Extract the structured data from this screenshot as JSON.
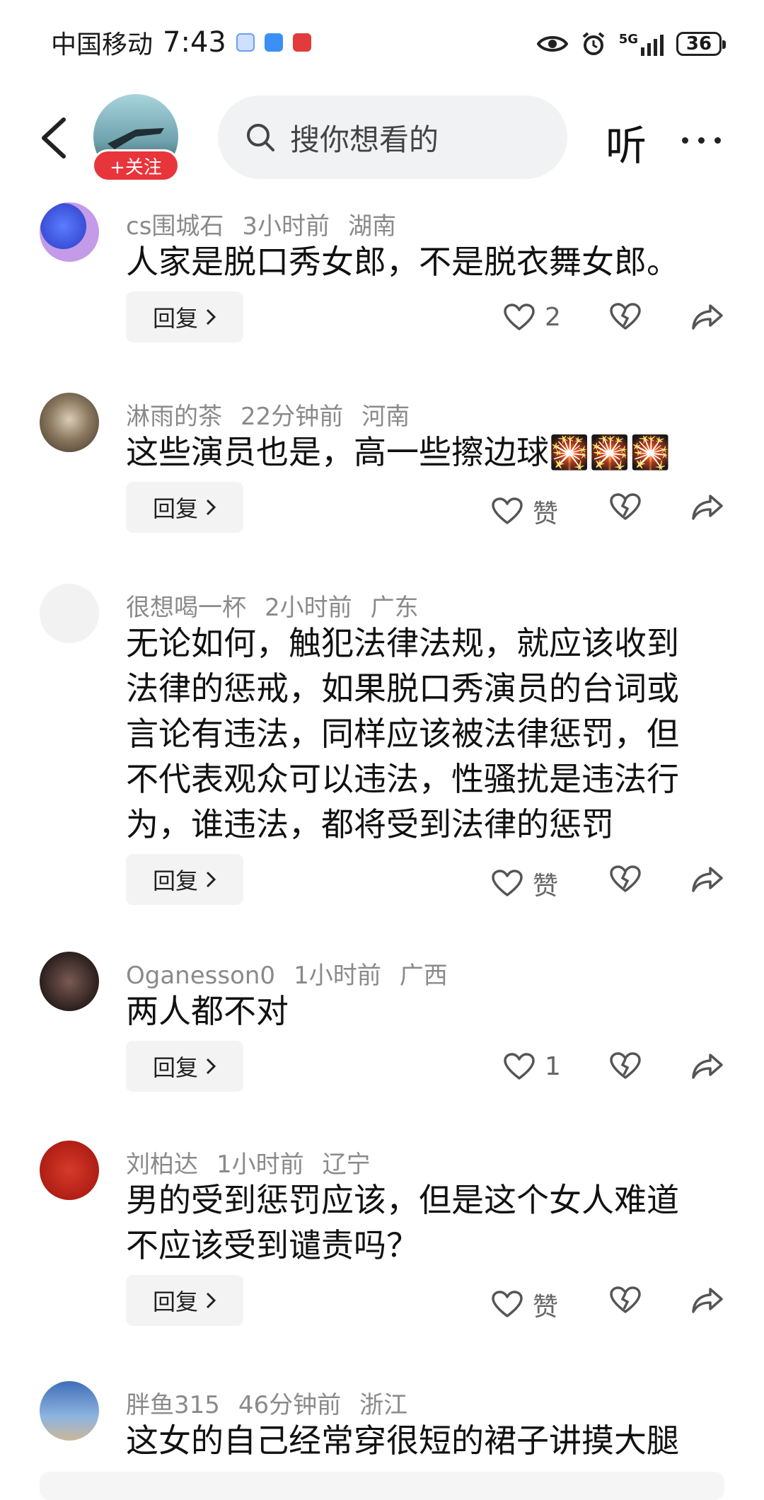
{
  "status_bar": {
    "carrier": "中国移动",
    "time": "7:43",
    "network": "5G",
    "battery": "36"
  },
  "nav": {
    "follow_label": "+关注",
    "search_placeholder": "搜你想看的",
    "listen_label": "听"
  },
  "comments": [
    {
      "user": "cs围城石",
      "time": "3小时前",
      "location": "湖南",
      "text": [
        "人家是脱口秀女郎，不是脱衣舞女郎。"
      ],
      "reply": "回复",
      "likes": "2"
    },
    {
      "user": "淋雨的茶",
      "time": "22分钟前",
      "location": "河南",
      "text": [
        "这些演员也是，高一些擦边球🎇🎇🎇"
      ],
      "reply": "回复",
      "likes": "赞"
    },
    {
      "user": "很想喝一杯",
      "time": "2小时前",
      "location": "广东",
      "text": [
        "无论如何，触犯法律法规，就应该收到",
        "法律的惩戒，如果脱口秀演员的台词或",
        "言论有违法，同样应该被法律惩罚，但",
        "不代表观众可以违法，性骚扰是违法行",
        "为，谁违法，都将受到法律的惩罚"
      ],
      "reply": "回复",
      "likes": "赞"
    },
    {
      "user": "Oganesson0",
      "time": "1小时前",
      "location": "广西",
      "text": [
        "两人都不对"
      ],
      "reply": "回复",
      "likes": "1"
    },
    {
      "user": "刘柏达",
      "time": "1小时前",
      "location": "辽宁",
      "text": [
        "男的受到惩罚应该，但是这个女人难道",
        "不应该受到谴责吗？"
      ],
      "reply": "回复",
      "likes": "赞"
    },
    {
      "user": "胖鱼315",
      "time": "46分钟前",
      "location": "浙江",
      "text": [
        "这女的自己经常穿很短的裙子讲摸大腿"
      ]
    }
  ],
  "colors": {
    "follow_red": "#e8353b",
    "meta_gray": "#8a8a8a",
    "reply_bg": "#f3f3f3"
  },
  "icons": [
    "chevron-left-icon",
    "search-icon",
    "more-icon",
    "heart-icon",
    "heart-broken-icon",
    "share-icon",
    "eye-icon",
    "alarm-icon",
    "signal-icon"
  ]
}
